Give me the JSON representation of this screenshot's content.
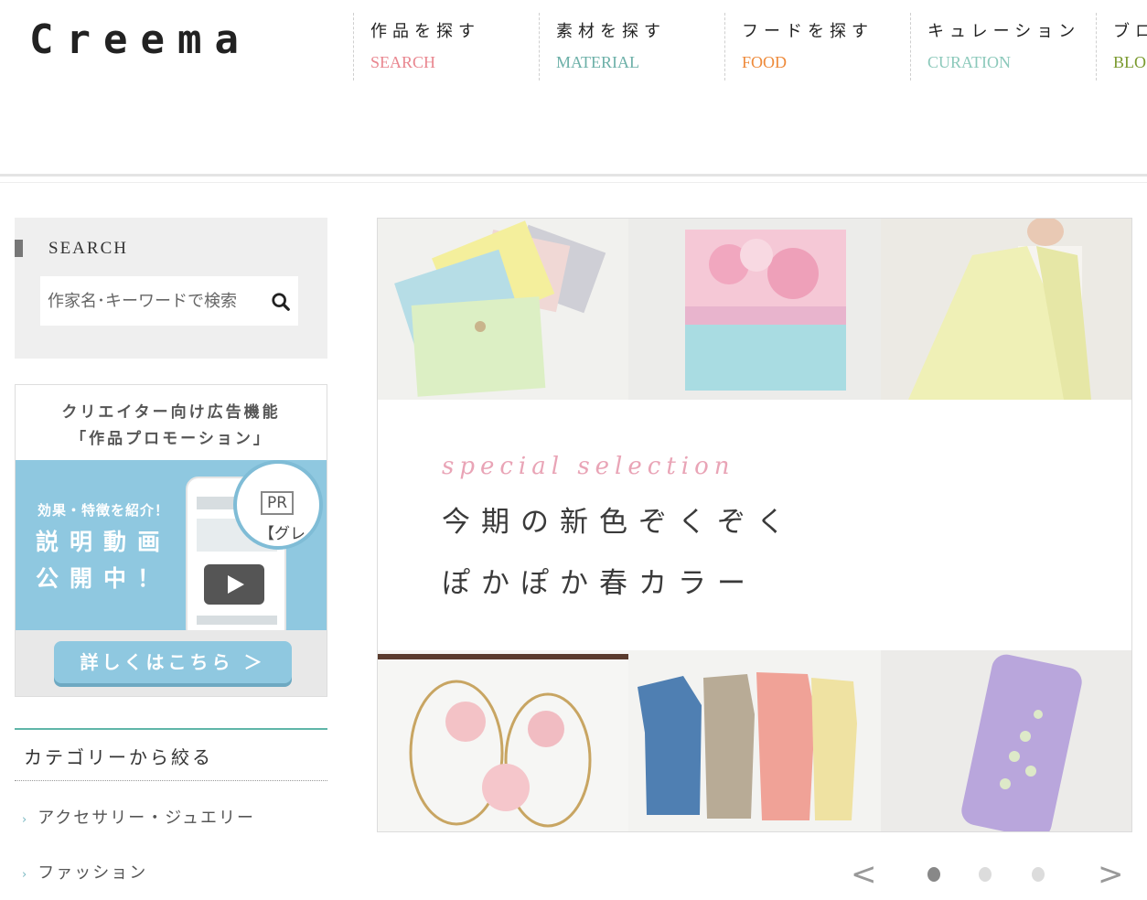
{
  "brand": {
    "logo_text": "Creema"
  },
  "nav": [
    {
      "jp": "作品を探す",
      "en": "SEARCH",
      "color": "#e9868f"
    },
    {
      "jp": "素材を探す",
      "en": "MATERIAL",
      "color": "#6cb0a8"
    },
    {
      "jp": "フードを探す",
      "en": "FOOD",
      "color": "#ee8a3a"
    },
    {
      "jp": "キュレーション",
      "en": "CURATION",
      "color": "#8cc9bb"
    },
    {
      "jp": "ブロ",
      "en": "BLO",
      "color": "#7a9a2e"
    }
  ],
  "search": {
    "title": "SEARCH",
    "placeholder": "作家名･キーワードで検索",
    "icon": "search-icon"
  },
  "promo": {
    "head_line1": "クリエイター向け広告機能",
    "head_line2": "「作品プロモーション」",
    "sub": "効果・特徴を紹介！",
    "big_line1": "説明動画",
    "big_line2": "公開中！",
    "pr_tag": "PR",
    "pr_text": "【グレ",
    "button": "詳しくはこちら ＞"
  },
  "categories": {
    "title": "カテゴリーから絞る",
    "items": [
      "アクセサリー・ジュエリー",
      "ファッション"
    ]
  },
  "banner": {
    "special": "special selection",
    "headline1": "今期の新色ぞくぞく",
    "headline2": "ぽかぽか春カラー"
  },
  "carousel": {
    "prev": "<",
    "next": ">",
    "dots": 3,
    "active_index": 0
  }
}
